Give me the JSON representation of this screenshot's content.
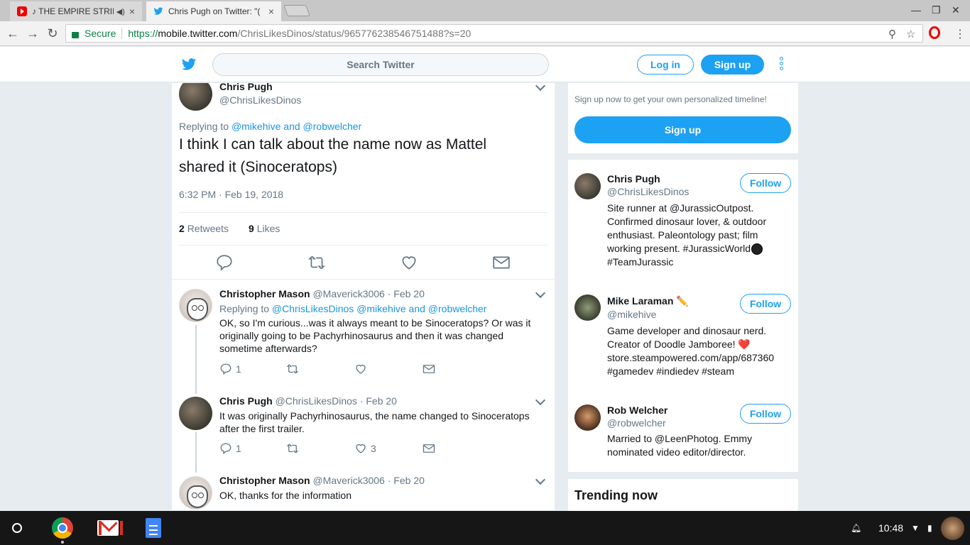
{
  "browser": {
    "tabs": [
      {
        "title": "♪ THE EMPIRE STRIKE",
        "favicon": "youtube-icon",
        "audio": true
      },
      {
        "title": "Chris Pugh on Twitter: \"(",
        "favicon": "twitter-icon",
        "active": true
      }
    ],
    "security_label": "Secure",
    "url": {
      "scheme": "https://",
      "host": "mobile.twitter.com",
      "path": "/ChrisLikesDinos/status/965776238546751488?s=20"
    }
  },
  "header": {
    "search_placeholder": "Search Twitter",
    "login_label": "Log in",
    "signup_label": "Sign up"
  },
  "tweet": {
    "author_name": "Chris Pugh",
    "author_handle": "@ChrisLikesDinos",
    "replying_prefix": "Replying to",
    "replying_handle_1": "@mikehive",
    "replying_and": "and",
    "replying_handle_2": "@robwelcher",
    "text_line_1": "I think I can talk about the name now as Mattel",
    "text_line_2": "shared it (Sinoceratops)",
    "timestamp": "6:32 PM · Feb 19, 2018",
    "retweets_count": "2",
    "retweets_label": "Retweets",
    "likes_count": "9",
    "likes_label": "Likes"
  },
  "replies": [
    {
      "name": "Christopher Mason",
      "handle": "@Maverick3006",
      "date": "· Feb 20",
      "replying_prefix": "Replying to",
      "replying_handles": "@ChrisLikesDinos @mikehive",
      "replying_and": "and",
      "replying_last": "@robwelcher",
      "text": "OK, so I'm curious...was it always meant to be Sinoceratops? Or was it originally going to be Pachyrhinosaurus and then it was changed sometime afterwards?",
      "reply_count": "1",
      "like_count": ""
    },
    {
      "name": "Chris Pugh",
      "handle": "@ChrisLikesDinos",
      "date": "· Feb 20",
      "text": "It was originally Pachyrhinosaurus, the name changed to Sinoceratops after the first trailer.",
      "reply_count": "1",
      "like_count": "3"
    },
    {
      "name": "Christopher Mason",
      "handle": "@Maverick3006",
      "date": "· Feb 20",
      "text": "OK, thanks for the information"
    }
  ],
  "sidebar": {
    "signup_note": "Sign up now to get your own personalized timeline!",
    "signup_label": "Sign up",
    "follow_label": "Follow",
    "users": [
      {
        "name": "Chris Pugh",
        "handle": "@ChrisLikesDinos",
        "bio_1": "Site runner at @JurassicOutpost.",
        "bio_2": "Confirmed dinosaur lover, & outdoor",
        "bio_3": "enthusiast. Paleontology past; film",
        "bio_4": "working present. #JurassicWorld",
        "bio_5": "#TeamJurassic"
      },
      {
        "name": "Mike Laraman ✏️",
        "handle": "@mikehive",
        "bio_1": "Game developer and dinosaur nerd.",
        "bio_2": "Creator of Doodle Jamboree! ❤️",
        "bio_3": "store.steampowered.com/app/687360",
        "bio_4": "#gamedev #indiedev #steam"
      },
      {
        "name": "Rob Welcher",
        "handle": "@robwelcher",
        "bio_1": "Married to @LeenPhotog. Emmy",
        "bio_2": "nominated video editor/director."
      }
    ],
    "trending_title": "Trending now"
  },
  "shelf": {
    "time": "10:48"
  },
  "colors": {
    "twitter_blue": "#1da1f2",
    "link_blue": "#1b95e0",
    "secure_green": "#0b8043"
  }
}
